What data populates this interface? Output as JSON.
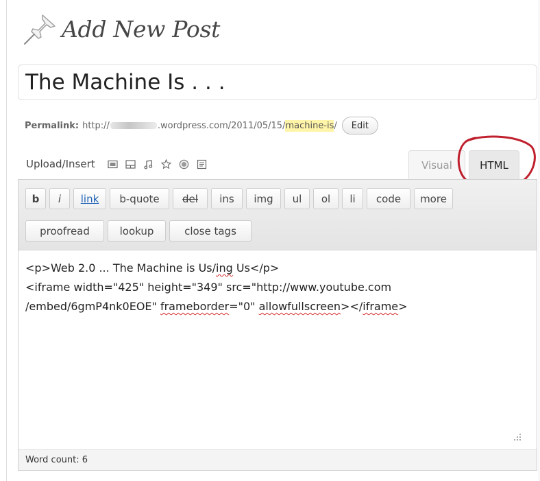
{
  "page": {
    "title": "Add New Post"
  },
  "post_title": {
    "value": "The Machine Is . . ."
  },
  "permalink": {
    "label": "Permalink:",
    "prefix": "http://",
    "domain_suffix": ".wordpress.com/2011/05/15/",
    "slug": "machine-is",
    "trailing": "/",
    "edit_label": "Edit"
  },
  "upload": {
    "label": "Upload/Insert",
    "icons": [
      "image-icon",
      "video-icon",
      "audio-icon",
      "media-icon",
      "poll-icon",
      "form-icon"
    ]
  },
  "tabs": {
    "visual": "Visual",
    "html": "HTML",
    "active": "HTML"
  },
  "quicktags": {
    "row1": [
      "b",
      "i",
      "link",
      "b-quote",
      "del",
      "ins",
      "img",
      "ul",
      "ol",
      "li",
      "code",
      "more"
    ],
    "row2": [
      "proofread",
      "lookup",
      "close tags"
    ]
  },
  "content": {
    "line1": "<p>Web 2.0 ... The Machine is Us/",
    "line1_squiggle": "ing",
    "line1_end": " Us</p>",
    "line2": "<iframe width=\"425\" height=\"349\" src=\"http://www.youtube.com",
    "line3_a": "/embed/6gmP4nk0EOE\" ",
    "line3_sq1": "frameborder",
    "line3_b": "=\"0\" ",
    "line3_sq2": "allowfullscreen",
    "line3_c": "></",
    "line3_sq3": "iframe",
    "line3_d": ">"
  },
  "status": {
    "word_count": "Word count: 6"
  },
  "colors": {
    "annotation": "#c0202e",
    "slug_highlight": "#fff5a8",
    "link": "#2163b8"
  }
}
